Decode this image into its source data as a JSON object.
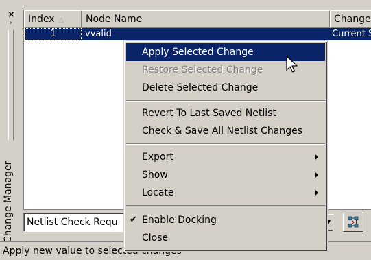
{
  "panel": {
    "title": "Change Manager",
    "close_glyph": "×"
  },
  "table": {
    "columns": [
      "Index",
      "Node Name",
      "Change"
    ],
    "sort_indicator": "△",
    "rows": [
      {
        "index": "1",
        "node_name": "vvalid",
        "change": "Current S"
      }
    ]
  },
  "toolbar": {
    "filter_combo_value": "Netlist Check Requ",
    "combo_arrow": "▼",
    "action_icon": "netlist-sync-icon"
  },
  "status_bar": {
    "text": "Apply new value to selected changes"
  },
  "context_menu": {
    "items": [
      {
        "label": "Apply Selected Change",
        "highlighted": true,
        "enabled": true
      },
      {
        "label": "Restore Selected Change",
        "enabled": false
      },
      {
        "label": "Delete Selected Change",
        "enabled": true
      },
      {
        "label": "Revert To Last Saved Netlist",
        "enabled": true
      },
      {
        "label": "Check & Save All Netlist Changes",
        "enabled": true
      },
      {
        "label": "Export",
        "submenu": true
      },
      {
        "label": "Show",
        "submenu": true
      },
      {
        "label": "Locate",
        "submenu": true
      },
      {
        "label": "Enable Docking",
        "checked": true,
        "check_glyph": "✔"
      },
      {
        "label": "Close",
        "enabled": true
      }
    ]
  },
  "colors": {
    "selection": "#0a246a",
    "face": "#d4d0c8"
  }
}
